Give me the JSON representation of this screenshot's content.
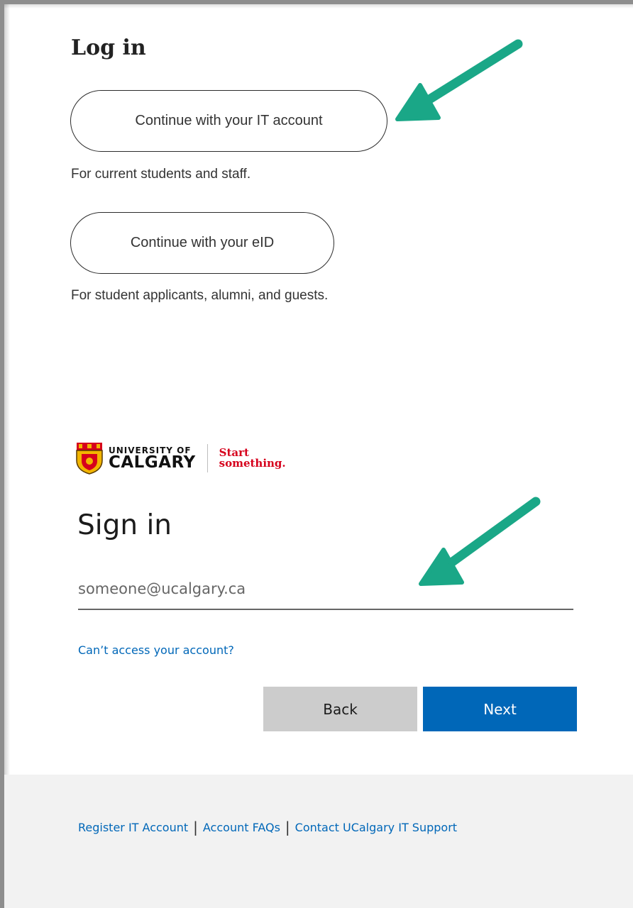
{
  "login": {
    "heading": "Log in",
    "it_button_label": "Continue with your IT account",
    "it_note": "For current students and staff.",
    "eid_button_label": "Continue with your eID",
    "eid_note": "For student applicants, alumni, and guests."
  },
  "logo": {
    "line1": "UNIVERSITY OF",
    "line2": "CALGARY",
    "tagline1": "Start",
    "tagline2": "something."
  },
  "signin": {
    "title": "Sign in",
    "email_placeholder": "someone@ucalgary.ca",
    "cant_access": "Can’t access your account?",
    "back_label": "Back",
    "next_label": "Next"
  },
  "footer": {
    "links": [
      "Register IT Account",
      "Account FAQs",
      "Contact UCalgary IT Support"
    ],
    "separator": "|"
  },
  "colors": {
    "arrow": "#1aa787",
    "primary": "#0067b8",
    "brand_red": "#d6001c"
  },
  "icons": [
    "annotation-arrow-icon",
    "university-crest-icon"
  ]
}
